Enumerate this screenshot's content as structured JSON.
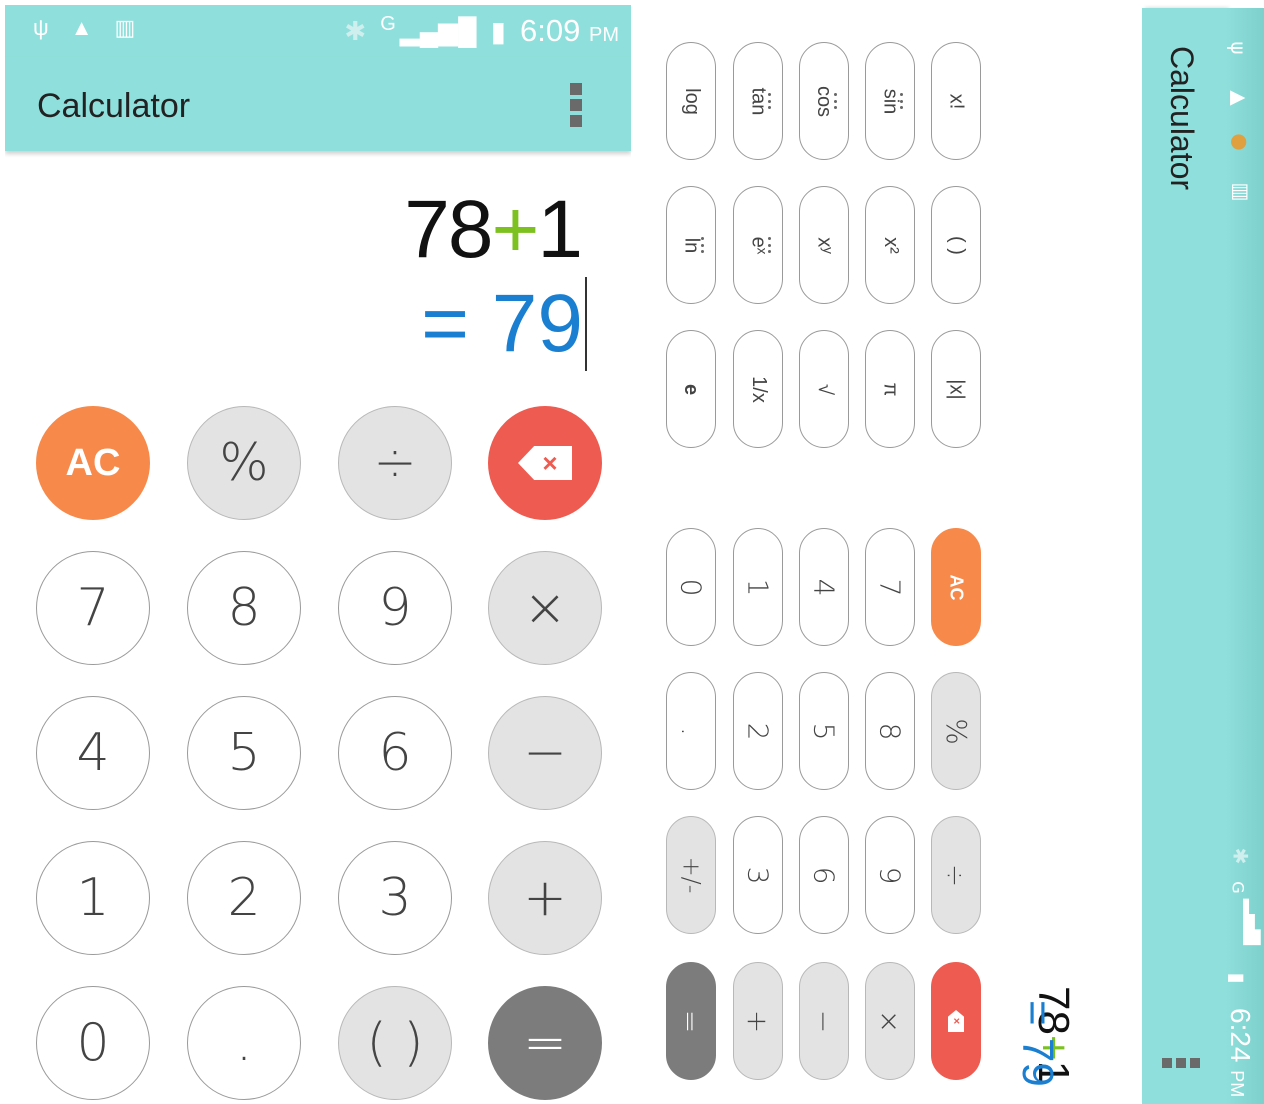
{
  "status_bar": {
    "time": "6:09",
    "ampm": "PM",
    "network": "G"
  },
  "app": {
    "title": "Calculator"
  },
  "display": {
    "operand1": "78",
    "operator": "+",
    "operand2": "1",
    "result": "= 79"
  },
  "keypad": {
    "ac": "AC",
    "percent": "%",
    "divide": "÷",
    "multiply": "×",
    "minus": "−",
    "plus": "+",
    "equals": "=",
    "dot": ".",
    "parens": "( )",
    "backspace_x": "×",
    "d0": "0",
    "d1": "1",
    "d2": "2",
    "d3": "3",
    "d4": "4",
    "d5": "5",
    "d6": "6",
    "d7": "7",
    "d8": "8",
    "d9": "9"
  },
  "scientific": {
    "log": "log",
    "tan": "tan",
    "cos": "cos",
    "sin": "sin",
    "factorial": "x!",
    "ln": "ln",
    "exp": "eˣ",
    "xpowy": "xʸ",
    "square": "x²",
    "parens": "( )",
    "e": "e",
    "reciprocal": "1/x",
    "sqrt": "√",
    "pi": "π",
    "abs": "|x|",
    "plusminus": "+/-"
  },
  "landscape": {
    "title": "Calculator",
    "time": "6:24",
    "ampm": "PM",
    "network": "G",
    "operand1": "78",
    "operator": "+",
    "operand2": "1",
    "result": "= 79"
  },
  "colors": {
    "accent": "#8fdfdc",
    "orange": "#f7894a",
    "red": "#ee5b50",
    "result_blue": "#1a7fd1",
    "plus_green": "#7cc11f"
  }
}
